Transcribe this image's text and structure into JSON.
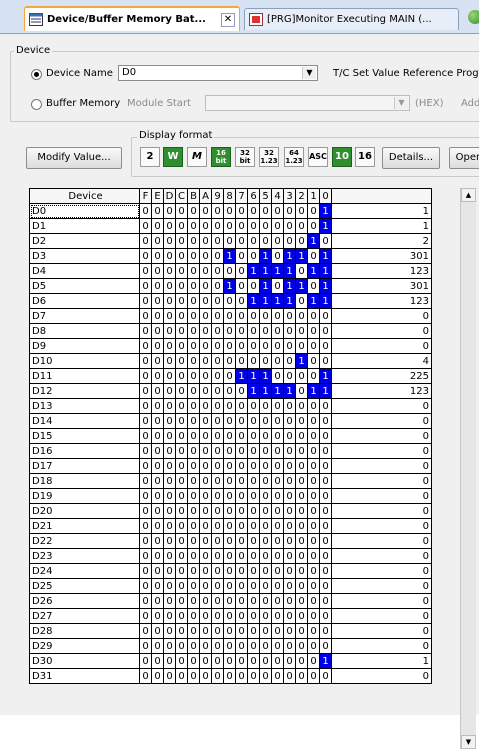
{
  "tabs": [
    {
      "label": "Device/Buffer Memory Bat...",
      "active": true
    },
    {
      "label": "[PRG]Monitor Executing MAIN (...",
      "active": false
    }
  ],
  "device_group": {
    "title": "Device",
    "device_name_label": "Device Name",
    "device_name_value": "D0",
    "tc_label": "T/C Set Value Reference Progr",
    "buffer_memory_label": "Buffer Memory",
    "module_start_label": "Module Start",
    "hex_label": "(HEX)",
    "add_label": "Add"
  },
  "modify_button": "Modify Value...",
  "display_format": {
    "title": "Display format",
    "buttons": [
      "2",
      "W",
      "M",
      "16",
      "32",
      "32",
      "64",
      "ASC",
      "10",
      "16"
    ],
    "details_button": "Details...",
    "open_button": "Open"
  },
  "grid": {
    "device_header": "Device",
    "bit_headers": [
      "F",
      "E",
      "D",
      "C",
      "B",
      "A",
      "9",
      "8",
      "7",
      "6",
      "5",
      "4",
      "3",
      "2",
      "1",
      "0"
    ],
    "rows": [
      {
        "device": "D0",
        "bits": "0000000000000001",
        "value": "1"
      },
      {
        "device": "D1",
        "bits": "0000000000000001",
        "value": "1"
      },
      {
        "device": "D2",
        "bits": "0000000000000010",
        "value": "2"
      },
      {
        "device": "D3",
        "bits": "0000000100101101",
        "value": "301"
      },
      {
        "device": "D4",
        "bits": "0000000001111011",
        "value": "123"
      },
      {
        "device": "D5",
        "bits": "0000000100101101",
        "value": "301"
      },
      {
        "device": "D6",
        "bits": "0000000001111011",
        "value": "123"
      },
      {
        "device": "D7",
        "bits": "0000000000000000",
        "value": "0"
      },
      {
        "device": "D8",
        "bits": "0000000000000000",
        "value": "0"
      },
      {
        "device": "D9",
        "bits": "0000000000000000",
        "value": "0"
      },
      {
        "device": "D10",
        "bits": "0000000000000100",
        "value": "4"
      },
      {
        "device": "D11",
        "bits": "0000000011100001",
        "value": "225"
      },
      {
        "device": "D12",
        "bits": "0000000001111011",
        "value": "123"
      },
      {
        "device": "D13",
        "bits": "0000000000000000",
        "value": "0"
      },
      {
        "device": "D14",
        "bits": "0000000000000000",
        "value": "0"
      },
      {
        "device": "D15",
        "bits": "0000000000000000",
        "value": "0"
      },
      {
        "device": "D16",
        "bits": "0000000000000000",
        "value": "0"
      },
      {
        "device": "D17",
        "bits": "0000000000000000",
        "value": "0"
      },
      {
        "device": "D18",
        "bits": "0000000000000000",
        "value": "0"
      },
      {
        "device": "D19",
        "bits": "0000000000000000",
        "value": "0"
      },
      {
        "device": "D20",
        "bits": "0000000000000000",
        "value": "0"
      },
      {
        "device": "D21",
        "bits": "0000000000000000",
        "value": "0"
      },
      {
        "device": "D22",
        "bits": "0000000000000000",
        "value": "0"
      },
      {
        "device": "D23",
        "bits": "0000000000000000",
        "value": "0"
      },
      {
        "device": "D24",
        "bits": "0000000000000000",
        "value": "0"
      },
      {
        "device": "D25",
        "bits": "0000000000000000",
        "value": "0"
      },
      {
        "device": "D26",
        "bits": "0000000000000000",
        "value": "0"
      },
      {
        "device": "D27",
        "bits": "0000000000000000",
        "value": "0"
      },
      {
        "device": "D28",
        "bits": "0000000000000000",
        "value": "0"
      },
      {
        "device": "D29",
        "bits": "0000000000000000",
        "value": "0"
      },
      {
        "device": "D30",
        "bits": "0000000000000001",
        "value": "1"
      },
      {
        "device": "D31",
        "bits": "0000000000000000",
        "value": "0"
      }
    ]
  },
  "colors": {
    "bit_on": "#0000e6",
    "tab_highlight": "#f7a63a",
    "format_selected": "#2f8f2f"
  }
}
